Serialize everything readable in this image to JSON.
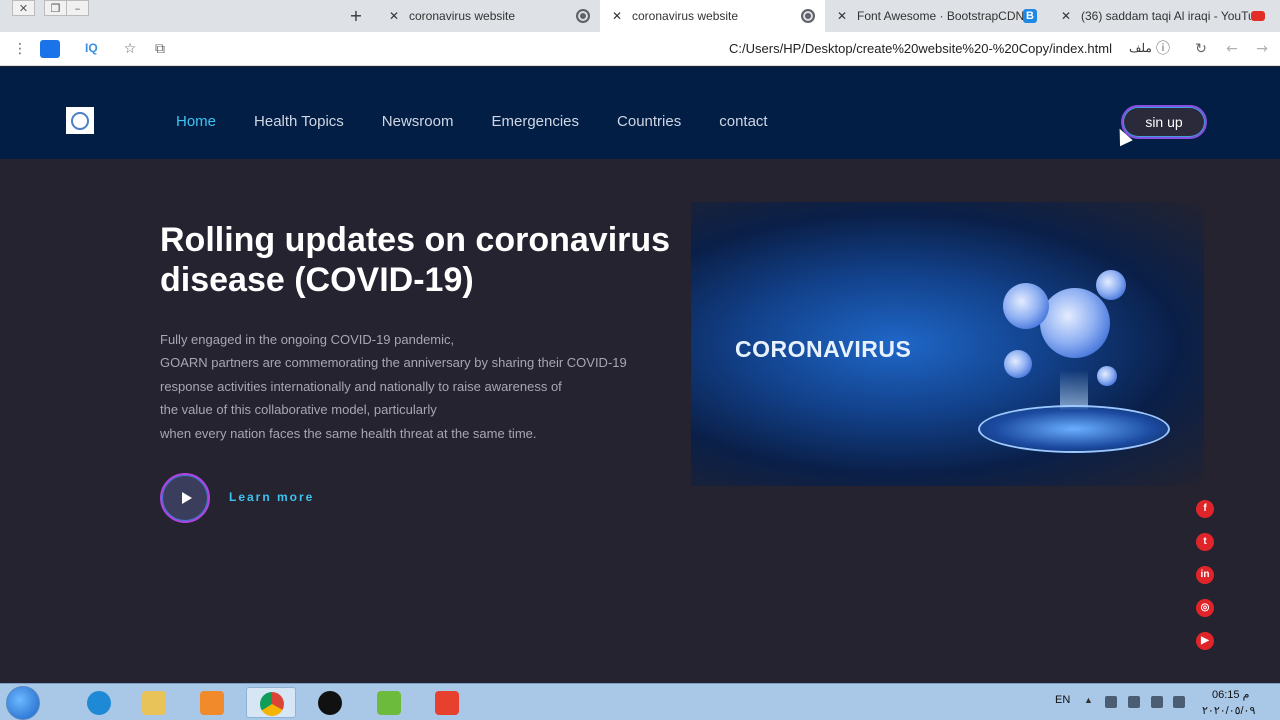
{
  "browser": {
    "tabs": [
      {
        "title": "coronavirus website",
        "active": false
      },
      {
        "title": "coronavirus website",
        "active": true
      },
      {
        "title": "Font Awesome · BootstrapCDN b",
        "active": false
      },
      {
        "title": "(36) saddam taqi Al iraqi - YouTu",
        "active": false
      }
    ],
    "new_tab_glyph": "+",
    "extension_label": "IQ",
    "url": "C:/Users/HP/Desktop/create%20website%20-%20Copy/index.html",
    "url_scheme_label": "ملف"
  },
  "header": {
    "nav": [
      "Home",
      "Health Topics",
      "Newsroom",
      "Emergencies",
      "Countries",
      "contact"
    ],
    "signup_label": "sin up"
  },
  "hero": {
    "title": "Rolling updates on coronavirus disease (COVID-19)",
    "paragraph_lines": [
      "Fully engaged in the ongoing COVID-19 pandemic,",
      "GOARN partners are commemorating the anniversary by sharing their COVID-19",
      "response activities internationally and nationally to raise awareness of",
      "the value of this collaborative model, particularly",
      "when every nation faces the same health threat at the same time."
    ],
    "learn_more": "Learn more",
    "image_caption": "CORONAVIRUS"
  },
  "social": [
    "facebook-icon",
    "twitter-icon",
    "linkedin-icon",
    "instagram-icon",
    "youtube-icon"
  ],
  "taskbar": {
    "lang": "EN",
    "time": "06:15 م",
    "date": "٢٠٢٠/٠٥/٠٩"
  },
  "colors": {
    "header_bg": "#021e45",
    "page_bg": "#24232f",
    "nav_active": "#3ec3f0",
    "accent_purple": "#8a4de0",
    "social_red": "#e0252a"
  }
}
